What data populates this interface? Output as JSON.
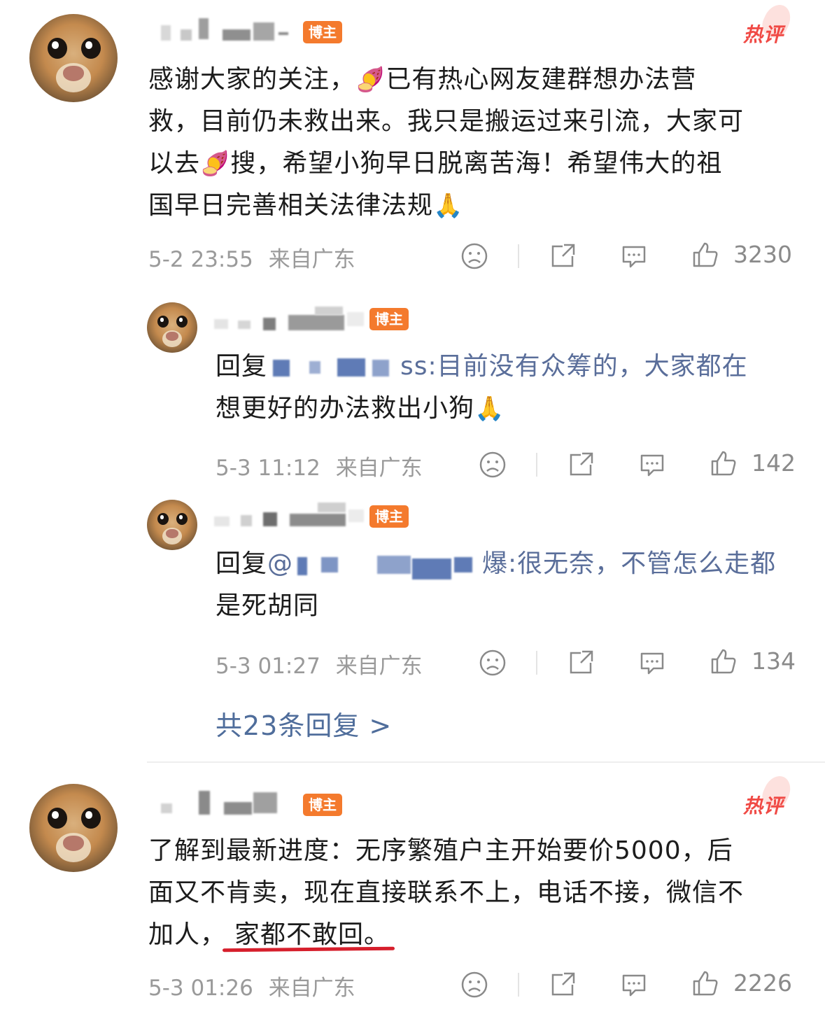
{
  "comments": [
    {
      "badge": "博主",
      "hot_label": "热评",
      "text_lines": [
        "感谢大家的关注，",
        "已有热心网友建群想办法营",
        "救，目前仍未救出来。我只是搬运过来引流，大家可",
        "以去",
        "搜，希望小狗早日脱离苦海！希望伟大的祖",
        "国早日完善相关法律法规"
      ],
      "timestamp": "5-2 23:55",
      "location": "来自广东",
      "likes": "3230"
    },
    {
      "badge": "博主",
      "text_lines": [
        "回复",
        "ss:目前没有众筹的，大家都在",
        "想更好的办法救出小狗"
      ],
      "timestamp": "5-3 11:12",
      "location": "来自广东",
      "likes": "142"
    },
    {
      "badge": "博主",
      "text_lines": [
        "回复",
        "@",
        "爆:很无奈，不管怎么走都",
        "是死胡同"
      ],
      "timestamp": "5-3 01:27",
      "location": "来自广东",
      "likes": "134"
    },
    {
      "badge": "博主",
      "hot_label": "热评",
      "text_lines": [
        "了解到最新进度：无序繁殖户主开始要价5000，后",
        "面又不肯卖，现在直接联系不上，电话不接，微信不",
        "加人，",
        "家都不敢回。"
      ],
      "timestamp": "5-3 01:26",
      "location": "来自广东",
      "likes": "2226"
    }
  ],
  "more_replies": "共23条回复 >",
  "icons": {
    "emoji": "🍠",
    "pray": "🙏",
    "dislike": "sad-face-icon",
    "share": "share-icon",
    "reply": "comment-icon",
    "like": "thumbs-up-icon"
  },
  "colors": {
    "badge": "#f47a2d",
    "hot": "#f04a45",
    "link": "#4f6d9b",
    "underline": "#d61f2c"
  }
}
